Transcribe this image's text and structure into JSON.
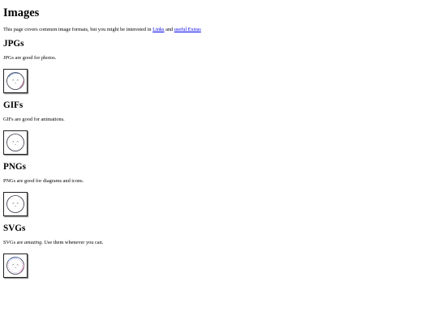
{
  "page": {
    "title": "Images",
    "intro": {
      "text_before": "This page covers common image formats, but you might be interested in ",
      "link1": "Links",
      "text_between": " and ",
      "link2": "useful Extras"
    }
  },
  "sections": [
    {
      "heading": "JPGs",
      "description": "JPGs are good for photos.",
      "image_icon": "face-drawing-icon"
    },
    {
      "heading": "GIFs",
      "description": "GIFs are good for animations.",
      "image_icon": "face-drawing-icon"
    },
    {
      "heading": "PNGs",
      "description": "PNGs are good for diagrams and icons.",
      "image_icon": "face-drawing-icon"
    },
    {
      "heading": "SVGs",
      "description_before": "SVGs are ",
      "description_emphasis": "amazing",
      "description_after": ". Use them whenever you can.",
      "image_icon": "face-drawing-icon"
    }
  ],
  "colors": {
    "link": "#0000ee",
    "text": "#000000",
    "background": "#ffffff"
  }
}
